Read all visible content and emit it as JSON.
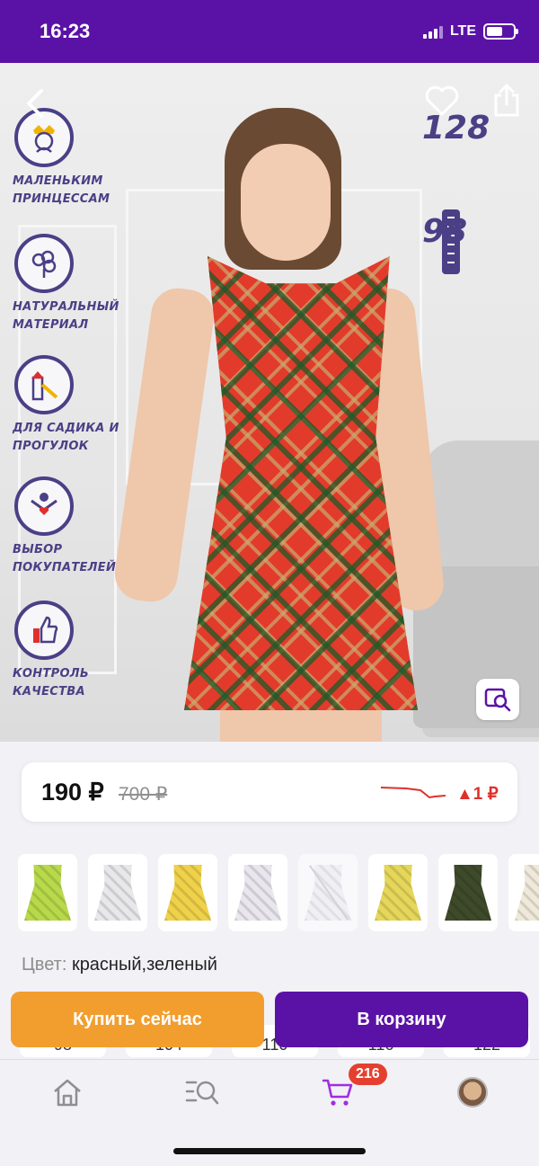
{
  "status_bar": {
    "time": "16:23",
    "network": "LTE",
    "battery_level": 0.6
  },
  "hero": {
    "features": [
      {
        "icon": "princess-crown-icon",
        "label": "МАЛЕНЬКИМ ПРИНЦЕССАМ"
      },
      {
        "icon": "cotton-icon",
        "label": "НАТУРАЛЬНЫЙ МАТЕРИАЛ"
      },
      {
        "icon": "playground-icon",
        "label": "ДЛЯ САДИКА И ПРОГУЛОК"
      },
      {
        "icon": "customer-choice-icon",
        "label": "ВЫБОР ПОКУПАТЕЛЕЙ"
      },
      {
        "icon": "thumbs-up-icon",
        "label": "КОНТРОЛЬ КАЧЕСТВА"
      }
    ],
    "size_max": "128",
    "size_min": "98"
  },
  "price": {
    "current": "190 ₽",
    "old": "700 ₽",
    "change": "▲1 ₽",
    "accent": "#e0302b"
  },
  "variants": [
    {
      "color": "#b8d94a",
      "faded": false
    },
    {
      "color": "#e8e8ea",
      "faded": false
    },
    {
      "color": "#f0d24a",
      "faded": false
    },
    {
      "color": "#e9e6ee",
      "faded": false
    },
    {
      "color": "#f0eef2",
      "faded": true
    },
    {
      "color": "#e6d75a",
      "faded": false
    },
    {
      "color": "#3e4a2a",
      "faded": false
    },
    {
      "color": "#efe9da",
      "faded": false
    }
  ],
  "color_info": {
    "label": "Цвет:",
    "value": "красный,зеленый"
  },
  "sizes": [
    "98",
    "104",
    "110",
    "116",
    "122"
  ],
  "actions": {
    "buy_now": "Купить сейчас",
    "add_to_cart": "В корзину"
  },
  "tabbar": {
    "cart_count": "216"
  },
  "colors": {
    "brand": "#5a12a6",
    "buy": "#f29e2f",
    "feature_ink": "#4b3f86"
  }
}
